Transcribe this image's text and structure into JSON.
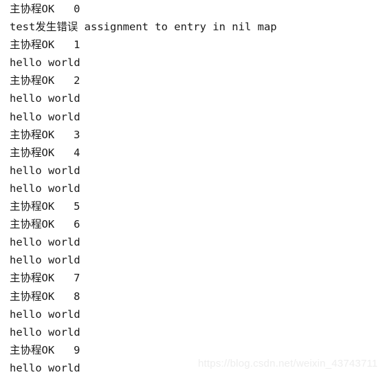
{
  "console": {
    "background_color": "#ffffff",
    "text_color": "#1a1a1a",
    "lines": [
      {
        "text": "主协程OK   0"
      },
      {
        "text": "test发生错误 assignment to entry in nil map"
      },
      {
        "text": "主协程OK   1"
      },
      {
        "text": "hello world"
      },
      {
        "text": "主协程OK   2"
      },
      {
        "text": "hello world"
      },
      {
        "text": "hello world"
      },
      {
        "text": "主协程OK   3"
      },
      {
        "text": "主协程OK   4"
      },
      {
        "text": "hello world"
      },
      {
        "text": "hello world"
      },
      {
        "text": "主协程OK   5"
      },
      {
        "text": "主协程OK   6"
      },
      {
        "text": "hello world"
      },
      {
        "text": "hello world"
      },
      {
        "text": "主协程OK   7"
      },
      {
        "text": "主协程OK   8"
      },
      {
        "text": "hello world"
      },
      {
        "text": "hello world"
      },
      {
        "text": "主协程OK   9"
      },
      {
        "text": "hello world"
      }
    ]
  },
  "watermark": {
    "text": "https://blog.csdn.net/weixin_43743711",
    "color": "#ededed"
  }
}
